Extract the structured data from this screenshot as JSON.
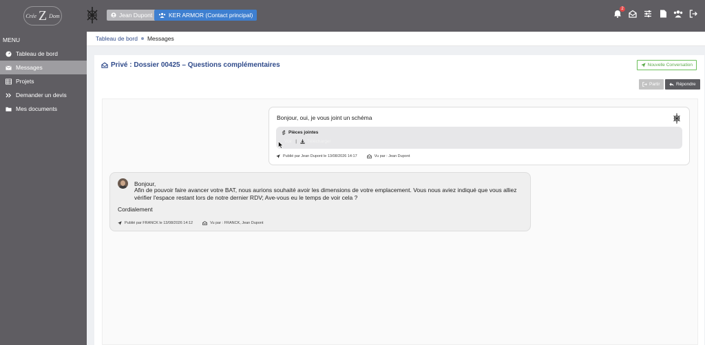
{
  "header": {
    "logo_left": "Crée",
    "logo_mid": "Z",
    "logo_right": "Dom",
    "user_name": "Jean Dupont",
    "org_label": "KER ARMOR (Contact principal)",
    "notifications_count": "2",
    "icons": [
      "bell-icon",
      "envelope-open-icon",
      "sliders-icon",
      "file-icon",
      "users-icon",
      "logout-icon"
    ]
  },
  "sidebar": {
    "title": "MENU",
    "items": [
      {
        "label": "Tableau de bord",
        "icon": "dashboard-icon"
      },
      {
        "label": "Messages",
        "icon": "envelope-icon"
      },
      {
        "label": "Projets",
        "icon": "table-icon"
      },
      {
        "label": "Demander un devis",
        "icon": "double-chevron-icon"
      },
      {
        "label": "Mes documents",
        "icon": "folder-icon"
      }
    ],
    "active_index": 1
  },
  "breadcrumb": {
    "root": "Tableau de bord",
    "current": "Messages"
  },
  "conversation": {
    "title": "Privé : Dossier 00425 – Questions complémentaires",
    "new_button": "Nouvelle Conversation",
    "leave_button": "Partir",
    "reply_button": "Répondre"
  },
  "messages": [
    {
      "text": "Bonjour, oui, je vous joint un schéma",
      "attachments_label": "Pièces jointes",
      "attachment_name": "Voir",
      "download_label": "Télécharger",
      "published": "Publié par Jean Dupont le 13/08/2026 14:17",
      "seen": "Vu par : Jean Dupont"
    },
    {
      "greeting": "Bonjour,",
      "body": "Afin de pouvoir faire avancer votre BAT, nous aurions souhaité avoir les dimensions de votre emplacement. Vous nous aviez indiqué que vous alliez vérifier l'espace restant lors de notre dernier RDV; Ave-vous eu le temps de voir cela ?",
      "signature": "Cordialement",
      "published": "Publié par FRANCK le 13/08/2026 14:12",
      "seen": "Vu par : FRANCK, Jean Dupont"
    }
  ],
  "colors": {
    "chrome": "#5f5d62",
    "accent_blue": "#3e7fd0",
    "title_blue": "#2f4a8a",
    "green": "#5aa948"
  }
}
